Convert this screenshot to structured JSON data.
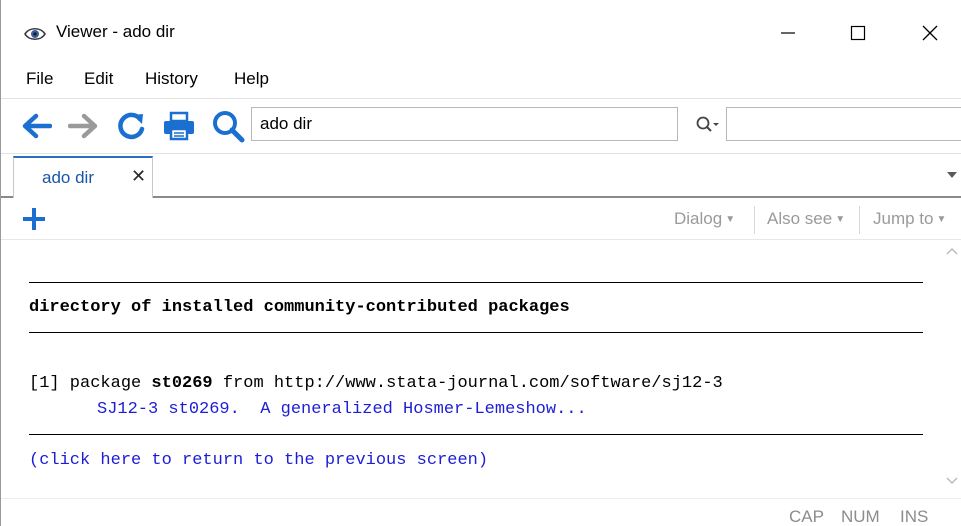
{
  "window": {
    "title": "Viewer - ado dir",
    "controls": {
      "minimize": "—",
      "maximize": "☐",
      "close": "✕"
    }
  },
  "menu": [
    "File",
    "Edit",
    "History",
    "Help"
  ],
  "toolbar": {
    "icons": [
      "back-arrow-icon",
      "forward-arrow-icon",
      "refresh-icon",
      "print-icon",
      "search-icon"
    ],
    "command_value": "ado dir",
    "find_value": ""
  },
  "tabs": [
    {
      "label": "ado dir",
      "close": "✕"
    }
  ],
  "subtoolbar": {
    "dialog": "Dialog",
    "also_see": "Also see",
    "jump_to": "Jump to"
  },
  "content": {
    "heading": "directory of installed community-contributed packages",
    "entry_prefix": "[1] package ",
    "entry_package": "st0269",
    "entry_suffix": " from http://www.stata-journal.com/software/sj12-3",
    "entry_description": "SJ12-3 st0269.  A generalized Hosmer-Lemeshow...",
    "return_link_open": "(",
    "return_link": "click here to return to the previous screen",
    "return_link_close": ")"
  },
  "status": [
    "CAP",
    "NUM",
    "INS"
  ],
  "colors": {
    "accent": "#1a6fd0",
    "link": "#1d1dd6",
    "disabled_text": "#9a9a9a",
    "tab_text": "#1a56a8"
  }
}
